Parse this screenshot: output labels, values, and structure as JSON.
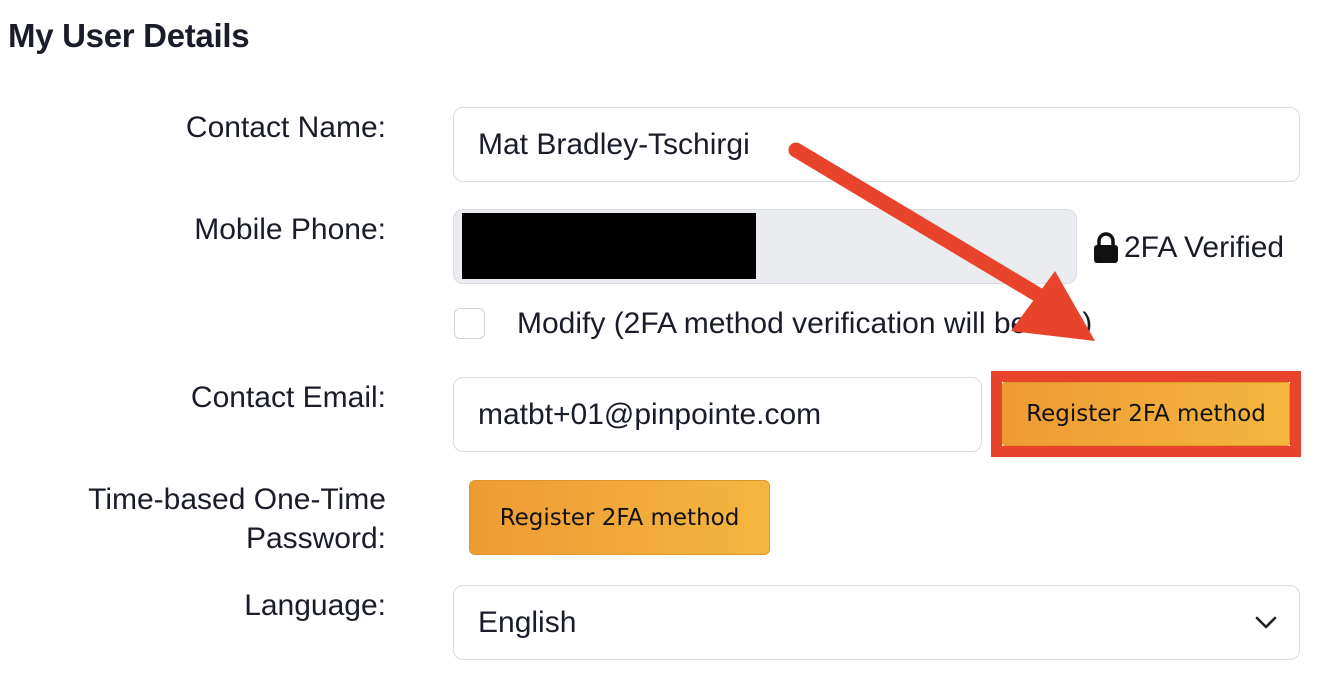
{
  "page": {
    "title": "My User Details"
  },
  "form": {
    "contact_name": {
      "label": "Contact Name:",
      "value": "Mat Bradley-Tschirgi"
    },
    "mobile_phone": {
      "label": "Mobile Phone:",
      "value": "",
      "redacted": true,
      "status_icon": "lock-icon",
      "status_text": "2FA Verified"
    },
    "modify_checkbox": {
      "label": "Modify (2FA method verification will be lost)",
      "checked": false
    },
    "contact_email": {
      "label": "Contact Email:",
      "value": "matbt+01@pinpointe.com",
      "button_label": "Register 2FA method"
    },
    "totp": {
      "label_line1": "Time-based One-Time",
      "label_line2": "Password:",
      "button_label": "Register 2FA method"
    },
    "language": {
      "label": "Language:",
      "selected": "English",
      "icon": "chevron-down-icon"
    }
  },
  "annotation": {
    "arrow_color": "#e8432b",
    "highlight_color": "#e8432b"
  },
  "colors": {
    "button_gradient_start": "#ef9b34",
    "button_gradient_end": "#f4b63f",
    "readonly_bg": "#ebecf0",
    "border": "#d9dce3"
  }
}
